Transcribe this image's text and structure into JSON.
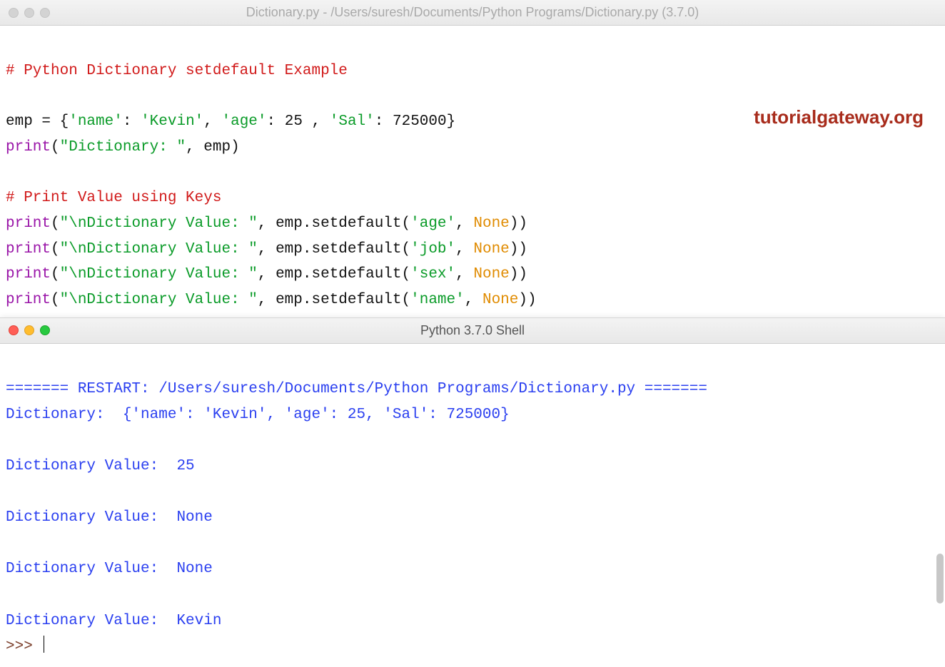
{
  "editor_window": {
    "title": "Dictionary.py - /Users/suresh/Documents/Python Programs/Dictionary.py (3.7.0)"
  },
  "shell_window": {
    "title": "Python 3.7.0 Shell"
  },
  "watermark": "tutorialgateway.org",
  "code": {
    "c1": "# Python Dictionary setdefault Example",
    "l2": {
      "a": "emp = {",
      "s1": "'name'",
      "colon1": ": ",
      "s2": "'Kevin'",
      "comma1": ", ",
      "s3": "'age'",
      "colon2": ": ",
      "n1": "25",
      "comma2": " , ",
      "s4": "'Sal'",
      "colon3": ": ",
      "n2": "725000",
      "end": "}"
    },
    "l3": {
      "pr": "print",
      "open": "(",
      "s": "\"Dictionary: \"",
      "rest": ", emp)"
    },
    "c2": "# Print Value using Keys",
    "p1": {
      "pr": "print",
      "open": "(",
      "s": "\"\\nDictionary Value: \"",
      "mid": ", emp.setdefault(",
      "key": "'age'",
      "comma": ", ",
      "none": "None",
      "close": "))"
    },
    "p2": {
      "pr": "print",
      "open": "(",
      "s": "\"\\nDictionary Value: \"",
      "mid": ", emp.setdefault(",
      "key": "'job'",
      "comma": ", ",
      "none": "None",
      "close": "))"
    },
    "p3": {
      "pr": "print",
      "open": "(",
      "s": "\"\\nDictionary Value: \"",
      "mid": ", emp.setdefault(",
      "key": "'sex'",
      "comma": ", ",
      "none": "None",
      "close": "))"
    },
    "p4": {
      "pr": "print",
      "open": "(",
      "s": "\"\\nDictionary Value: \"",
      "mid": ", emp.setdefault(",
      "key": "'name'",
      "comma": ", ",
      "none": "None",
      "close": "))"
    }
  },
  "shell": {
    "restart": "======= RESTART: /Users/suresh/Documents/Python Programs/Dictionary.py =======",
    "line1": "Dictionary:  {'name': 'Kevin', 'age': 25, 'Sal': 725000}",
    "blank": "",
    "v1": "Dictionary Value:  25",
    "v2": "Dictionary Value:  None",
    "v3": "Dictionary Value:  None",
    "v4": "Dictionary Value:  Kevin",
    "prompt": ">>> "
  }
}
